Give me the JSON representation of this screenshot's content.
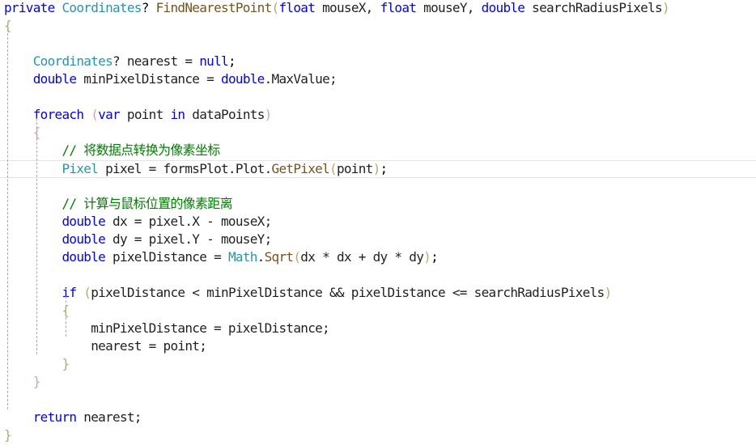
{
  "editor": {
    "lines": [
      {
        "tokens": [
          {
            "t": "private",
            "c": "kw"
          },
          {
            "t": " ",
            "c": "ws"
          },
          {
            "t": "Coordinates",
            "c": "type"
          },
          {
            "t": "? ",
            "c": "pun"
          },
          {
            "t": "FindNearestPoint",
            "c": "fn"
          },
          {
            "t": "(",
            "c": "br1"
          },
          {
            "t": "float",
            "c": "kw"
          },
          {
            "t": " mouseX, ",
            "c": "id"
          },
          {
            "t": "float",
            "c": "kw"
          },
          {
            "t": " mouseY, ",
            "c": "id"
          },
          {
            "t": "double",
            "c": "kw"
          },
          {
            "t": " searchRadiusPixels",
            "c": "id"
          },
          {
            "t": ")",
            "c": "br1"
          }
        ]
      },
      {
        "tokens": [
          {
            "t": "{",
            "c": "br1"
          }
        ]
      },
      {
        "tokens": []
      },
      {
        "tokens": [
          {
            "t": "    ",
            "c": "ws"
          },
          {
            "t": "Coordinates",
            "c": "type"
          },
          {
            "t": "? nearest = ",
            "c": "id"
          },
          {
            "t": "null",
            "c": "kw"
          },
          {
            "t": ";",
            "c": "pun"
          }
        ]
      },
      {
        "tokens": [
          {
            "t": "    ",
            "c": "ws"
          },
          {
            "t": "double",
            "c": "kw"
          },
          {
            "t": " minPixelDistance = ",
            "c": "id"
          },
          {
            "t": "double",
            "c": "kw"
          },
          {
            "t": ".MaxValue;",
            "c": "id"
          }
        ]
      },
      {
        "tokens": []
      },
      {
        "tokens": [
          {
            "t": "    ",
            "c": "ws"
          },
          {
            "t": "foreach",
            "c": "kw"
          },
          {
            "t": " ",
            "c": "ws"
          },
          {
            "t": "(",
            "c": "br2"
          },
          {
            "t": "var",
            "c": "kw"
          },
          {
            "t": " point ",
            "c": "id"
          },
          {
            "t": "in",
            "c": "kw"
          },
          {
            "t": " dataPoints",
            "c": "id"
          },
          {
            "t": ")",
            "c": "br2"
          }
        ]
      },
      {
        "tokens": [
          {
            "t": "    ",
            "c": "ws"
          },
          {
            "t": "{",
            "c": "br2"
          }
        ]
      },
      {
        "tokens": [
          {
            "t": "        ",
            "c": "ws"
          },
          {
            "t": "// 将数据点转换为像素坐标",
            "c": "cm"
          }
        ]
      },
      {
        "current": true,
        "tokens": [
          {
            "t": "        ",
            "c": "ws"
          },
          {
            "t": "Pixel",
            "c": "type"
          },
          {
            "t": " pixel = formsPlot.Plot.",
            "c": "id"
          },
          {
            "t": "GetPixel",
            "c": "fn"
          },
          {
            "t": "(",
            "c": "br1"
          },
          {
            "t": "point",
            "c": "id"
          },
          {
            "t": ")",
            "c": "br1"
          },
          {
            "t": ";",
            "c": "pun"
          }
        ]
      },
      {
        "tokens": []
      },
      {
        "tokens": [
          {
            "t": "        ",
            "c": "ws"
          },
          {
            "t": "// 计算与鼠标位置的像素距离",
            "c": "cm"
          }
        ]
      },
      {
        "tokens": [
          {
            "t": "        ",
            "c": "ws"
          },
          {
            "t": "double",
            "c": "kw"
          },
          {
            "t": " dx = pixel.X - mouseX;",
            "c": "id"
          }
        ]
      },
      {
        "tokens": [
          {
            "t": "        ",
            "c": "ws"
          },
          {
            "t": "double",
            "c": "kw"
          },
          {
            "t": " dy = pixel.Y - mouseY;",
            "c": "id"
          }
        ]
      },
      {
        "tokens": [
          {
            "t": "        ",
            "c": "ws"
          },
          {
            "t": "double",
            "c": "kw"
          },
          {
            "t": " pixelDistance = ",
            "c": "id"
          },
          {
            "t": "Math",
            "c": "type"
          },
          {
            "t": ".",
            "c": "id"
          },
          {
            "t": "Sqrt",
            "c": "fn"
          },
          {
            "t": "(",
            "c": "br1"
          },
          {
            "t": "dx * dx + dy * dy",
            "c": "id"
          },
          {
            "t": ")",
            "c": "br1"
          },
          {
            "t": ";",
            "c": "pun"
          }
        ]
      },
      {
        "tokens": []
      },
      {
        "tokens": [
          {
            "t": "        ",
            "c": "ws"
          },
          {
            "t": "if",
            "c": "kw"
          },
          {
            "t": " ",
            "c": "ws"
          },
          {
            "t": "(",
            "c": "br1"
          },
          {
            "t": "pixelDistance < minPixelDistance && pixelDistance <= searchRadiusPixels",
            "c": "id"
          },
          {
            "t": ")",
            "c": "br1"
          }
        ]
      },
      {
        "tokens": [
          {
            "t": "        ",
            "c": "ws"
          },
          {
            "t": "{",
            "c": "br1"
          }
        ]
      },
      {
        "tokens": [
          {
            "t": "            ",
            "c": "ws"
          },
          {
            "t": "minPixelDistance = pixelDistance;",
            "c": "id"
          }
        ]
      },
      {
        "tokens": [
          {
            "t": "            ",
            "c": "ws"
          },
          {
            "t": "nearest = point;",
            "c": "id"
          }
        ]
      },
      {
        "tokens": [
          {
            "t": "        ",
            "c": "ws"
          },
          {
            "t": "}",
            "c": "br1"
          }
        ]
      },
      {
        "tokens": [
          {
            "t": "    ",
            "c": "ws"
          },
          {
            "t": "}",
            "c": "br2"
          }
        ]
      },
      {
        "tokens": []
      },
      {
        "tokens": [
          {
            "t": "    ",
            "c": "ws"
          },
          {
            "t": "return",
            "c": "kw"
          },
          {
            "t": " nearest;",
            "c": "id"
          }
        ]
      },
      {
        "tokens": [
          {
            "t": "}",
            "c": "br1"
          }
        ]
      }
    ]
  }
}
